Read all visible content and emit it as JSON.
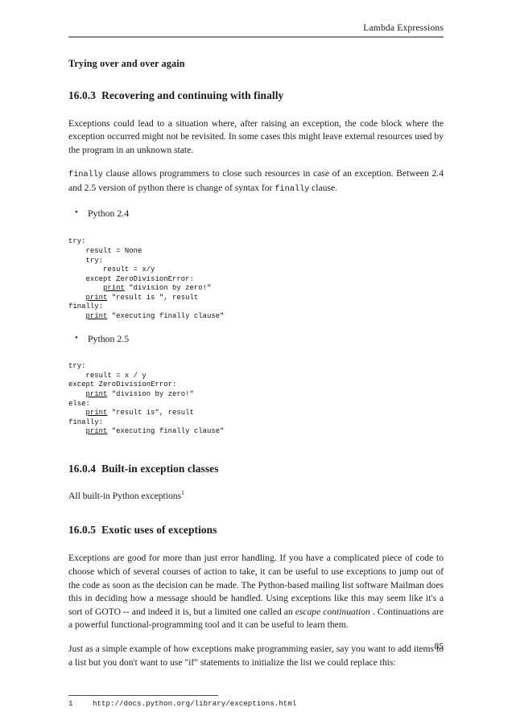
{
  "header": {
    "running_title": "Lambda Expressions"
  },
  "subheading": "Trying over and over again",
  "sections": [
    {
      "number": "16.0.3",
      "title": "Recovering and continuing with finally"
    },
    {
      "number": "16.0.4",
      "title": "Built-in exception classes"
    },
    {
      "number": "16.0.5",
      "title": "Exotic uses of exceptions"
    }
  ],
  "paragraphs": {
    "p1": "Exceptions could lead to a situation where, after raising an exception, the code block where the exception occurred might not be revisited. In some cases this might leave external resources used by the program in an unknown state.",
    "p2_code1": "finally",
    "p2_part1": " clause allows programmers to close such resources in case of an exception. Between 2.4 and 2.5 version of python there is change of syntax for ",
    "p2_code2": "finally",
    "p2_part2": " clause.",
    "p3_pre": "All built-in Python exceptions",
    "p3_sup": "1",
    "p4_part1": "Exceptions are good for more than just error handling. If you have a complicated piece of code to choose which of several courses of action to take, it can be useful to use exceptions to jump out of the code as soon as the decision can be made. The Python-based mailing list software Mailman does this in deciding how a message should be handled. Using exceptions like this may seem like it's a sort of GOTO -- and indeed it is, but a limited one called an ",
    "p4_italic": "escape continuation",
    "p4_part2": " . Continuations are a powerful functional-programming tool and it can be useful to learn them.",
    "p5": "Just as a simple example of how exceptions make programming easier, say you want to add items to a list but you don't want to use \"if\" statements to initialize the list we could replace this:"
  },
  "bullets": [
    "Python 2.4",
    "Python 2.5"
  ],
  "code_blocks": [
    {
      "id": "python24",
      "lines": [
        {
          "pre": "try:",
          "kw": "",
          "post": ""
        },
        {
          "pre": "    result = None",
          "kw": "",
          "post": ""
        },
        {
          "pre": "    try:",
          "kw": "",
          "post": ""
        },
        {
          "pre": "        result = x/y",
          "kw": "",
          "post": ""
        },
        {
          "pre": "    except ZeroDivisionError:",
          "kw": "",
          "post": ""
        },
        {
          "pre": "        ",
          "kw": "print",
          "post": " \"division by zero!\""
        },
        {
          "pre": "    ",
          "kw": "print",
          "post": " \"result is \", result"
        },
        {
          "pre": "finally:",
          "kw": "",
          "post": ""
        },
        {
          "pre": "    ",
          "kw": "print",
          "post": " \"executing finally clause\""
        }
      ]
    },
    {
      "id": "python25",
      "lines": [
        {
          "pre": "try:",
          "kw": "",
          "post": ""
        },
        {
          "pre": "    result = x / y",
          "kw": "",
          "post": ""
        },
        {
          "pre": "except ZeroDivisionError:",
          "kw": "",
          "post": ""
        },
        {
          "pre": "    ",
          "kw": "print",
          "post": " \"division by zero!\""
        },
        {
          "pre": "else:",
          "kw": "",
          "post": ""
        },
        {
          "pre": "    ",
          "kw": "print",
          "post": " \"result is\", result"
        },
        {
          "pre": "finally:",
          "kw": "",
          "post": ""
        },
        {
          "pre": "    ",
          "kw": "print",
          "post": " \"executing finally clause\""
        }
      ]
    }
  ],
  "footnote": {
    "marker": "1",
    "text": "http://docs.python.org/library/exceptions.html"
  },
  "page_number": "85"
}
